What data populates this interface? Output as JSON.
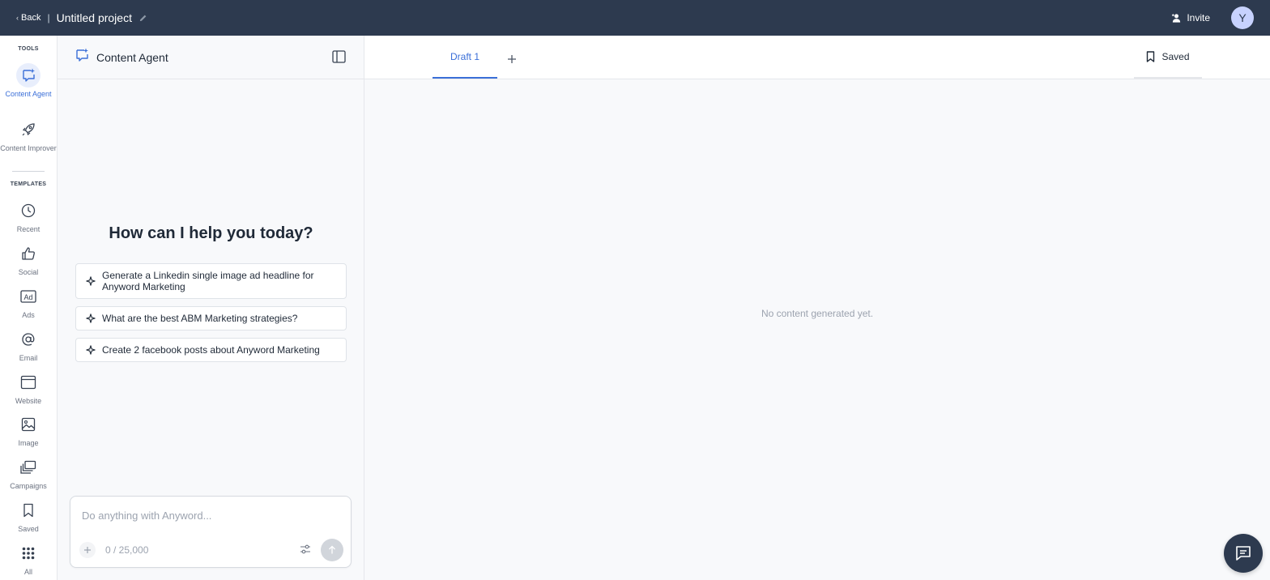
{
  "topbar": {
    "back_label": "Back",
    "project_title": "Untitled project",
    "invite_label": "Invite",
    "avatar_initial": "Y"
  },
  "rail": {
    "tools_heading": "TOOLS",
    "templates_heading": "TEMPLATES",
    "tools": [
      {
        "label": "Content Agent",
        "icon": "content-agent-icon",
        "active": true
      },
      {
        "label": "Content Improver",
        "icon": "rocket-icon",
        "active": false
      }
    ],
    "templates": [
      {
        "label": "Recent",
        "icon": "clock-icon"
      },
      {
        "label": "Social",
        "icon": "thumbs-up-icon"
      },
      {
        "label": "Ads",
        "icon": "ad-icon"
      },
      {
        "label": "Email",
        "icon": "at-sign-icon"
      },
      {
        "label": "Website",
        "icon": "browser-icon"
      },
      {
        "label": "Image",
        "icon": "image-icon"
      },
      {
        "label": "Campaigns",
        "icon": "stack-icon"
      },
      {
        "label": "Saved",
        "icon": "bookmark-icon"
      },
      {
        "label": "All",
        "icon": "grid-icon"
      }
    ]
  },
  "agent": {
    "title": "Content Agent",
    "heading": "How can I help you today?",
    "suggestions": [
      "Generate a Linkedin single image ad headline for Anyword Marketing",
      "What are the best ABM Marketing strategies?",
      "Create 2 facebook posts about Anyword Marketing"
    ],
    "input_placeholder": "Do anything with Anyword...",
    "counter": "0 / 25,000"
  },
  "main": {
    "tab_label": "Draft 1",
    "saved_label": "Saved",
    "empty_message": "No content generated yet."
  },
  "colors": {
    "topbar": "#2d3a4f",
    "accent": "#3b6fd8"
  }
}
